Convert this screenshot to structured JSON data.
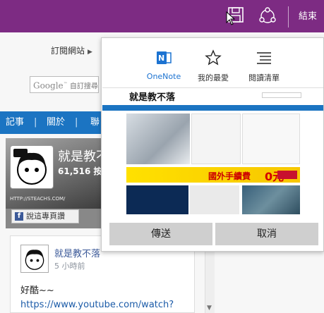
{
  "topbar": {
    "save_icon": "save-icon",
    "share_icon": "share-icon",
    "end_label": "結束",
    "color": "#7d2b83"
  },
  "page": {
    "subscribe_label": "訂閱網站",
    "search_placeholder": "自訂搜尋",
    "search_brand": "Google",
    "nav": [
      "記事",
      "|",
      "關於",
      "|",
      "聯"
    ],
    "nav_color": "#1b74c2",
    "widget": {
      "name": "就是教不落",
      "likes": "61,516 按讚",
      "url": "HTTP://STEACHS.COM/",
      "like_button": "說這專頁讚"
    },
    "post": {
      "name": "就是教不落",
      "time": "5 小時前",
      "text": "好酷~~",
      "link": "https://www.youtube.com/watch?"
    }
  },
  "share": {
    "tabs": [
      {
        "label": "OneNote",
        "icon": "onenote-icon",
        "active": true
      },
      {
        "label": "我的最愛",
        "icon": "star-icon",
        "active": false
      },
      {
        "label": "閱讀清單",
        "icon": "reading-list-icon",
        "active": false
      }
    ],
    "preview": {
      "logo": "就是教不落",
      "ad_text": "國外手續費",
      "ad_zero": "0元"
    },
    "send_label": "傳送",
    "cancel_label": "取消",
    "accent": "#1c73d1"
  }
}
